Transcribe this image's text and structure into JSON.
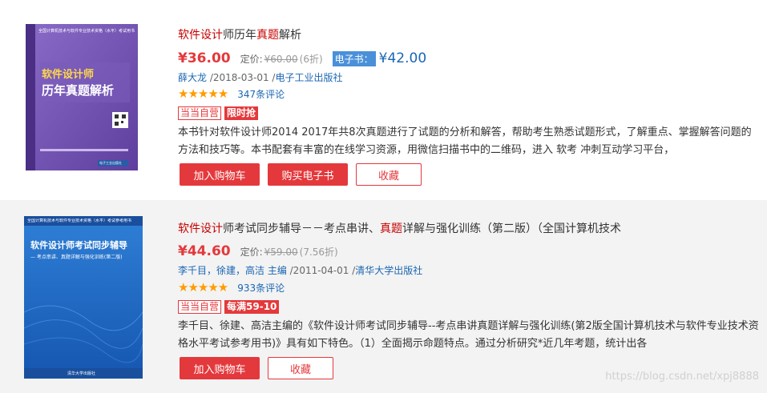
{
  "items": [
    {
      "title_hl1": "软件设计",
      "title_mid": "师历年",
      "title_hl2": "真题",
      "title_rest": "解析",
      "price": "¥36.00",
      "list_label": "定价:",
      "list_price": "¥60.00",
      "discount": "(6折)",
      "ebook_label": "电子书：",
      "ebook_price": "¥42.00",
      "author": "薛大龙",
      "date": " /2018-03-01 /",
      "publisher": "电子工业出版社",
      "stars": "★★★★★",
      "reviews": "347条评论",
      "badge1": "当当自营",
      "badge2": "限时抢",
      "description": "本书针对软件设计师2014 2017年共8次真题进行了试题的分析和解答，帮助考生熟悉试题形式，了解重点、掌握解答问题的方法和技巧等。本书配套有丰富的在线学习资源，用微信扫描书中的二维码，进入 软考 冲刺互动学习平台，",
      "btn_cart": "加入购物车",
      "btn_buy_ebook": "购买电子书",
      "btn_fav": "收藏",
      "cover": {
        "top": "全国计算机技术与软件专业技术资格（水平）考试用书",
        "t1": "软件设计师",
        "t2": "历年真题解析",
        "bottom": "电子工业出版社"
      }
    },
    {
      "title_hl1": "软件设计",
      "title_mid": "师考试同步辅导－－考点串讲、",
      "title_hl2": "真题",
      "title_rest": "详解与强化训练（第二版）（全国计算机技术",
      "price": "¥44.60",
      "list_label": "定价:",
      "list_price": "¥59.00",
      "discount": "(7.56折)",
      "author": "李千目，徐建，高洁 主编",
      "date": " /2011-04-01 /",
      "publisher": "清华大学出版社",
      "stars": "★★★★★",
      "reviews": "933条评论",
      "badge1": "当当自营",
      "badge2": "每满59-10",
      "description": "李千目、徐建、高洁主编的《软件设计师考试同步辅导--考点串讲真题详解与强化训练(第2版全国计算机技术与软件专业技术资格水平考试参考用书)》具有如下特色。（1）全面揭示命题特点。通过分析研究*近几年考题，统计出各",
      "btn_cart": "加入购物车",
      "btn_fav": "收藏",
      "cover": {
        "top": "全国计算机技术与软件专业技术资格（水平）考试参考用书",
        "t1": "软件设计师考试同步辅导",
        "t2": "— 考点串讲、真题详解与强化训练(第二版)",
        "bottom": "清华大学出版社"
      }
    }
  ],
  "watermark": "https://blog.csdn.net/xpj8888",
  "colors": {
    "accent": "#e4393c",
    "link": "#1a66b3",
    "star": "#ff9b00"
  }
}
